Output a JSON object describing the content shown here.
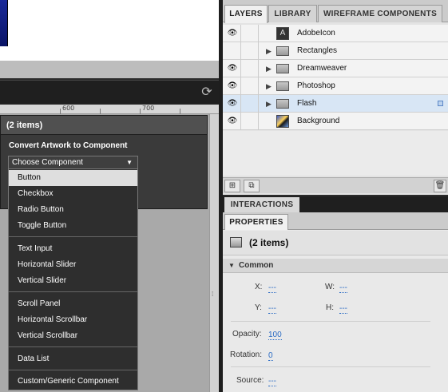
{
  "canvas": {
    "ruler_labels": [
      "600",
      "700"
    ]
  },
  "popup": {
    "header": "(2 items)",
    "convert_label": "Convert Artwork to Component",
    "select_value": "Choose Component",
    "menu_items": [
      "Button",
      "Checkbox",
      "Radio Button",
      "Toggle Button",
      "Text Input",
      "Horizontal Slider",
      "Vertical Slider",
      "Scroll Panel",
      "Horizontal Scrollbar",
      "Vertical Scrollbar",
      "Data List",
      "Custom/Generic Component"
    ]
  },
  "layers_panel": {
    "tabs": [
      "LAYERS",
      "LIBRARY",
      "WIREFRAME COMPONENTS"
    ],
    "layers": [
      {
        "name": "AdobeIcon",
        "visible": true,
        "expandable": false,
        "thumb": "adobe-icon"
      },
      {
        "name": "Rectangles",
        "visible": false,
        "expandable": true,
        "thumb": "folder-icon"
      },
      {
        "name": "Dreamweaver",
        "visible": true,
        "expandable": true,
        "thumb": "folder-icon"
      },
      {
        "name": "Photoshop",
        "visible": true,
        "expandable": true,
        "thumb": "folder-icon"
      },
      {
        "name": "Flash",
        "visible": true,
        "expandable": true,
        "thumb": "folder-icon",
        "selected": true
      },
      {
        "name": "Background",
        "visible": true,
        "expandable": false,
        "thumb": "image-thumbnail"
      }
    ]
  },
  "interactions": {
    "tab": "INTERACTIONS"
  },
  "properties": {
    "tab": "PROPERTIES",
    "title": "(2 items)",
    "section": "Common",
    "x_label": "X:",
    "x_value": "---",
    "w_label": "W:",
    "w_value": "---",
    "y_label": "Y:",
    "y_value": "---",
    "h_label": "H:",
    "h_value": "---",
    "opacity_label": "Opacity:",
    "opacity_value": "100",
    "rotation_label": "Rotation:",
    "rotation_value": "0",
    "source_label": "Source:",
    "source_value": "---"
  },
  "colors": {
    "dark_panel": "#3a3a3a",
    "selection_blue": "#d8e6f5",
    "link_blue": "#2a6bc4"
  }
}
